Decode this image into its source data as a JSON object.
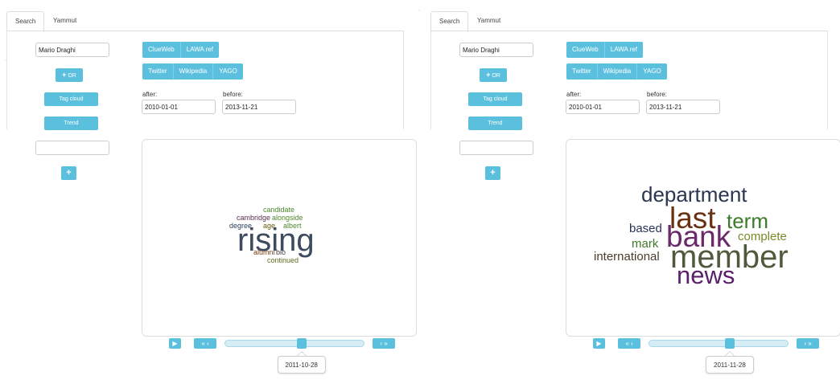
{
  "tabs": [
    "Search",
    "Yammut"
  ],
  "panels": [
    {
      "query": "Mario Draghi",
      "or_label": "OR",
      "tag_cloud_label": "Tag cloud",
      "trend_label": "Trend",
      "sources_row1": [
        "ClueWeb",
        "LAWA ref"
      ],
      "sources_row2": [
        "Twitter",
        "Wikipedia",
        "YAGO"
      ],
      "after_label": "after:",
      "after_value": "2010-01-01",
      "before_label": "before:",
      "before_value": "2013-11-21",
      "slider_value": "2011-10-28",
      "slider_fraction": 0.55,
      "cloud": [
        {
          "text": "candidate",
          "color": "#4e8a2e"
        },
        {
          "text": "cambridge",
          "color": "#5a2b52"
        },
        {
          "text": "alongside",
          "color": "#4e8a2e"
        },
        {
          "text": "degree",
          "color": "#2a3f5f"
        },
        {
          "text": "age",
          "color": "#6a5a10"
        },
        {
          "text": "albert",
          "color": "#4e8a2e"
        },
        {
          "text": "rising",
          "color": "#3d4b5f"
        },
        {
          "text": "alumni",
          "color": "#7a3d12"
        },
        {
          "text": "bio",
          "color": "#3d3d3d"
        },
        {
          "text": "continued",
          "color": "#5a6b1e"
        }
      ]
    },
    {
      "query": "Mario Draghi",
      "or_label": "OR",
      "tag_cloud_label": "Tag cloud",
      "trend_label": "Trend",
      "sources_row1": [
        "ClueWeb",
        "LAWA ref"
      ],
      "sources_row2": [
        "Twitter",
        "Wikipedia",
        "YAGO"
      ],
      "after_label": "after:",
      "after_value": "2010-01-01",
      "before_label": "before:",
      "before_value": "2013-11-21",
      "slider_value": "2011-11-28",
      "slider_fraction": 0.58,
      "cloud": [
        {
          "text": "department",
          "color": "#2a3550"
        },
        {
          "text": "based",
          "color": "#24345a"
        },
        {
          "text": "last",
          "color": "#6a3012"
        },
        {
          "text": "term",
          "color": "#3f7a2a"
        },
        {
          "text": "mark",
          "color": "#3f7a2a"
        },
        {
          "text": "bank",
          "color": "#6a2a6a"
        },
        {
          "text": "complete",
          "color": "#7a8a2a"
        },
        {
          "text": "international",
          "color": "#4a3d2a"
        },
        {
          "text": "member",
          "color": "#4f5a3d"
        },
        {
          "text": "news",
          "color": "#5a1f6a"
        }
      ]
    }
  ],
  "colors": {
    "accent": "#5bc0de"
  },
  "icons": [
    "plus-icon",
    "play-icon",
    "step-backward-icon",
    "step-forward-icon"
  ]
}
